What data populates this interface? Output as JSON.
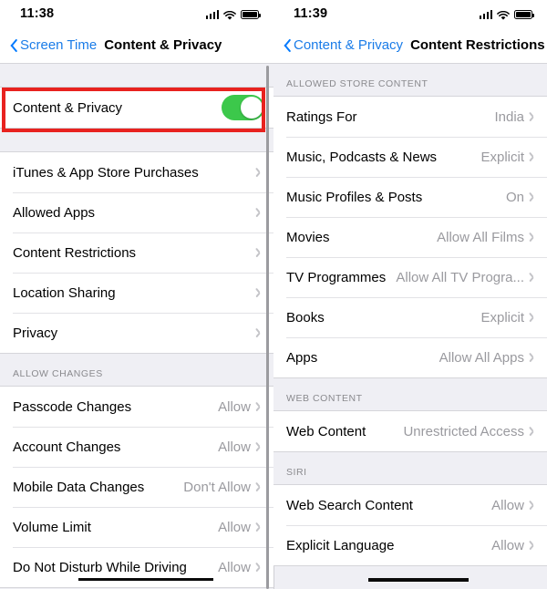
{
  "left_panel": {
    "status_bar": {
      "time": "11:38",
      "signal_icon": "cellular-signal-icon",
      "wifi_icon": "wifi-icon",
      "battery_icon": "battery-full-icon"
    },
    "nav": {
      "back_label": "Screen Time",
      "back_icon": "chevron-left-icon",
      "title": "Content & Privacy"
    },
    "toggle_row": {
      "label": "Content & Privacy",
      "state": "on",
      "accent_color": "#3cc84b"
    },
    "highlight_color": "#e8221f",
    "group_main": [
      {
        "label": "iTunes & App Store Purchases",
        "value": "",
        "accessory": "chevron-right-icon"
      },
      {
        "label": "Allowed Apps",
        "value": "",
        "accessory": "chevron-right-icon"
      },
      {
        "label": "Content Restrictions",
        "value": "",
        "accessory": "chevron-right-icon"
      },
      {
        "label": "Location Sharing",
        "value": "",
        "accessory": "chevron-right-icon"
      },
      {
        "label": "Privacy",
        "value": "",
        "accessory": "chevron-right-icon"
      }
    ],
    "section_allow_changes": {
      "header": "ALLOW CHANGES",
      "rows": [
        {
          "label": "Passcode Changes",
          "value": "Allow",
          "accessory": "chevron-right-icon"
        },
        {
          "label": "Account Changes",
          "value": "Allow",
          "accessory": "chevron-right-icon"
        },
        {
          "label": "Mobile Data Changes",
          "value": "Don't Allow",
          "accessory": "chevron-right-icon"
        },
        {
          "label": "Volume Limit",
          "value": "Allow",
          "accessory": "chevron-right-icon"
        },
        {
          "label": "Do Not Disturb While Driving",
          "value": "Allow",
          "accessory": "chevron-right-icon"
        }
      ]
    }
  },
  "right_panel": {
    "status_bar": {
      "time": "11:39",
      "signal_icon": "cellular-signal-icon",
      "wifi_icon": "wifi-icon",
      "battery_icon": "battery-full-icon"
    },
    "nav": {
      "back_label": "Content & Privacy",
      "back_icon": "chevron-left-icon",
      "title": "Content Restrictions"
    },
    "section_store": {
      "header": "ALLOWED STORE CONTENT",
      "rows": [
        {
          "label": "Ratings For",
          "value": "India",
          "accessory": "chevron-right-icon"
        },
        {
          "label": "Music, Podcasts & News",
          "value": "Explicit",
          "accessory": "chevron-right-icon"
        },
        {
          "label": "Music Profiles & Posts",
          "value": "On",
          "accessory": "chevron-right-icon"
        },
        {
          "label": "Movies",
          "value": "Allow All Films",
          "accessory": "chevron-right-icon"
        },
        {
          "label": "TV Programmes",
          "value": "Allow All TV Progra...",
          "accessory": "chevron-right-icon"
        },
        {
          "label": "Books",
          "value": "Explicit",
          "accessory": "chevron-right-icon"
        },
        {
          "label": "Apps",
          "value": "Allow All Apps",
          "accessory": "chevron-right-icon"
        }
      ]
    },
    "section_web": {
      "header": "WEB CONTENT",
      "rows": [
        {
          "label": "Web Content",
          "value": "Unrestricted Access",
          "accessory": "chevron-right-icon"
        }
      ]
    },
    "section_siri": {
      "header": "SIRI",
      "rows": [
        {
          "label": "Web Search Content",
          "value": "Allow",
          "accessory": "chevron-right-icon"
        },
        {
          "label": "Explicit Language",
          "value": "Allow",
          "accessory": "chevron-right-icon"
        }
      ]
    }
  }
}
